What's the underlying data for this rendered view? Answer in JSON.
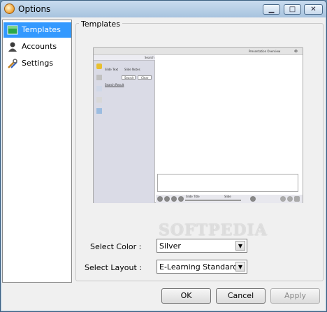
{
  "window": {
    "title": "Options"
  },
  "sidebar": {
    "items": [
      {
        "label": "Templates",
        "icon": "template-icon",
        "selected": true
      },
      {
        "label": "Accounts",
        "icon": "user-icon",
        "selected": false
      },
      {
        "label": "Settings",
        "icon": "settings-icon",
        "selected": false
      }
    ]
  },
  "templates": {
    "group_title": "Templates",
    "preview": {
      "header_text": "Presentation Overview",
      "search_label": "Search",
      "checkbox_1": "Slide Text",
      "checkbox_2": "Slide Notes",
      "search_button": "Search",
      "clear_button": "Clear",
      "search_result": "Search Result",
      "slide_title": "Slide Title",
      "slide_label": "Slide"
    },
    "color_label": "Select Color :",
    "color_value": "Silver",
    "layout_label": "Select Layout :",
    "layout_value": "E-Learning Standard"
  },
  "footer": {
    "ok_label": "OK",
    "cancel_label": "Cancel",
    "apply_label": "Apply"
  },
  "watermark": "SOFTPEDIA"
}
